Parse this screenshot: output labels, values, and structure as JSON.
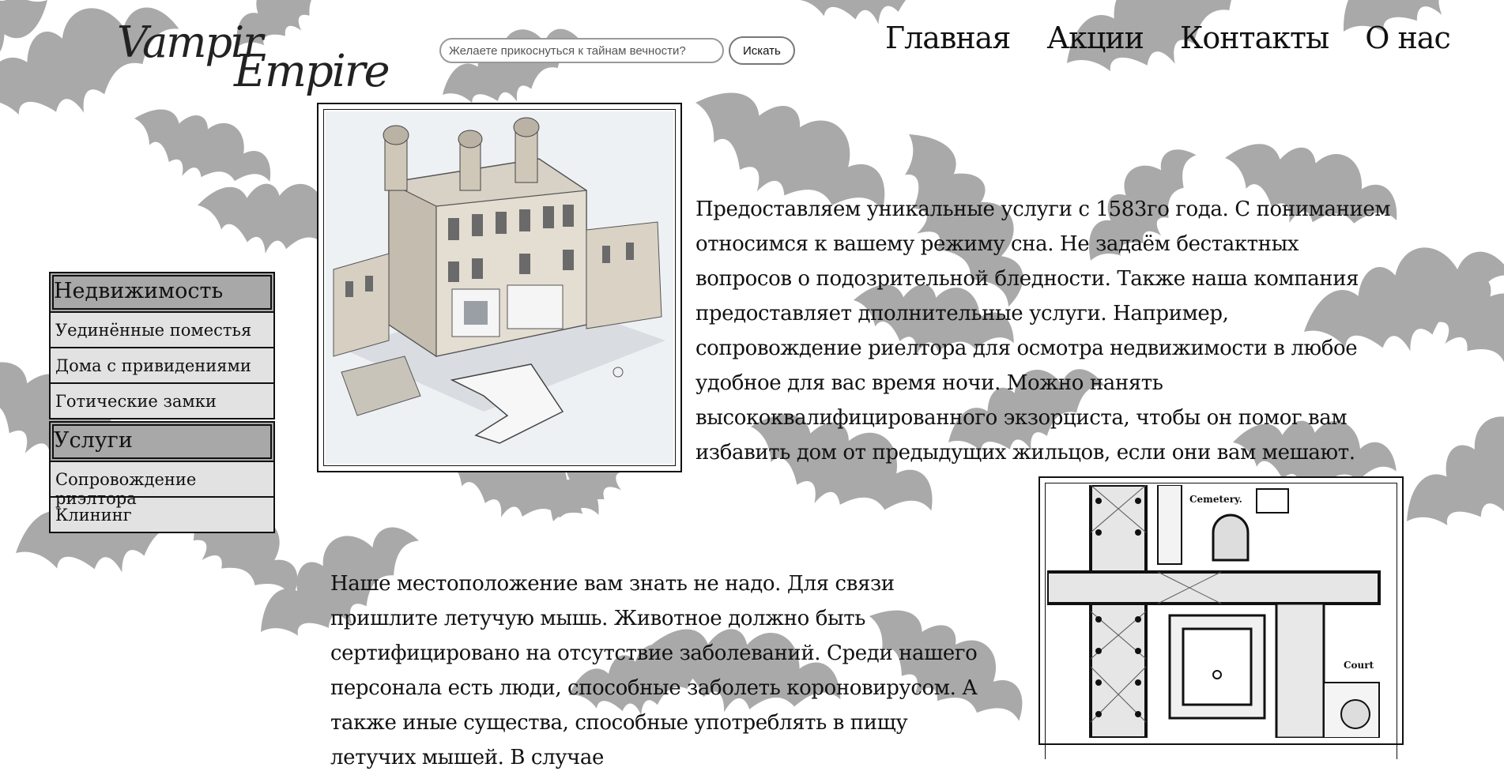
{
  "header": {
    "logo_line1": "VampirEmpire",
    "logo_part1": "Vampir",
    "logo_part2": "Empire",
    "search_placeholder": "Желаете прикоснуться к тайнам вечности?",
    "search_button": "Искать",
    "nav": [
      "Главная",
      "Акции",
      "Контакты",
      "О нас"
    ]
  },
  "sidebar": {
    "category1": "Недвижимость",
    "items1": [
      "Уединённые поместья",
      "Дома с привидениями",
      "Готические замки"
    ],
    "category2": "Услуги",
    "items2": [
      "Сопровождение риэлтора",
      "Клининг"
    ]
  },
  "main": {
    "paragraph1": "Предоставляем уникальные услуги с 1583го года. С пониманием относимся к вашему режиму сна. Не задаём бестактных вопросов о подозрительной бледности. Также наша компания предоставляет дполнительные услуги. Например, сопровождение риелтора для осмотра недвижимости в любое удобное для вас время ночи. Можно нанять высококвалифицированного экзорциста, чтобы он помог вам избавить дом от предыдущих жильцов, если они вам мешают.",
    "paragraph2": "Наше местоположение вам знать не надо. Для связи пришлите летучую мышь. Животное должно быть сертифицировано на отсутствие заболеваний. Среди нашего персонала есть люди, способные заболеть короновирусом. А также иные существа, способные употреблять в пищу летучих мышей. В случае",
    "plan_labels": [
      "Cemetery.",
      "Court"
    ]
  },
  "colors": {
    "bat_gray": "#a9a9a9",
    "category_bg": "#a8a8a8",
    "item_bg": "#e2e2e2"
  },
  "icons": {
    "castle_illustration": "castle-cutaway-drawing",
    "floor_plan": "cathedral-floor-plan"
  }
}
